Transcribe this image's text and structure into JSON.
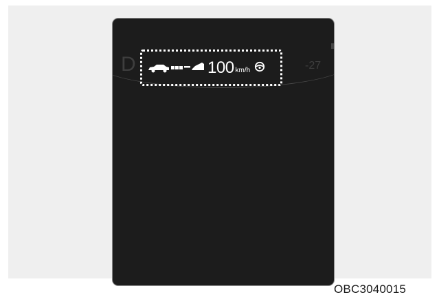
{
  "display": {
    "gear_indicator": "D",
    "outside_temp": "-27",
    "set_speed": "100",
    "speed_unit": "km/h",
    "icons": [
      "vehicle-ahead-icon",
      "distance-bars-icon",
      "own-car-icon",
      "steering-wheel-icon"
    ]
  },
  "caption": "OBC3040015",
  "colors": {
    "screen_bg": "#1c1c1c",
    "highlight": "#ffffff",
    "background_panel": "#efefef"
  }
}
